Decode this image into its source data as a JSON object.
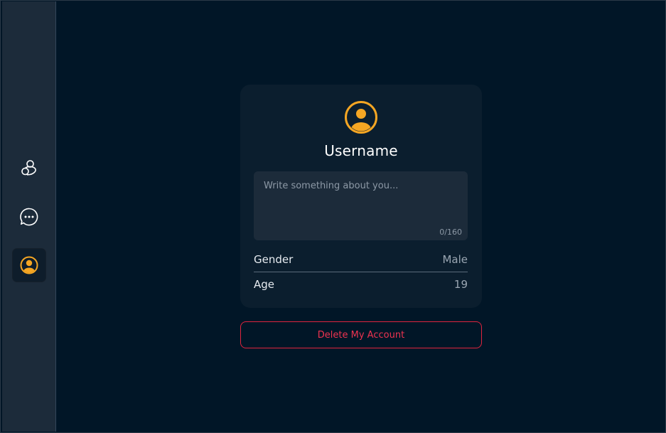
{
  "colors": {
    "accent": "#f5a623",
    "danger": "#e0243e",
    "sidebar": "#1c2b3a",
    "background": "#011627",
    "card": "#0b1e2e"
  },
  "sidebar": {
    "items": [
      {
        "icon": "friends-icon",
        "active": false
      },
      {
        "icon": "chat-bubble-icon",
        "active": false
      },
      {
        "icon": "profile-icon",
        "active": true
      }
    ]
  },
  "profile": {
    "avatar_icon": "user-circle-icon",
    "username": "Username",
    "bio": {
      "value": "",
      "placeholder": "Write something about you...",
      "char_count": "0/160"
    },
    "fields": {
      "gender": {
        "label": "Gender",
        "value": "Male"
      },
      "age": {
        "label": "Age",
        "value": "19"
      }
    }
  },
  "actions": {
    "delete_label": "Delete My Account"
  }
}
